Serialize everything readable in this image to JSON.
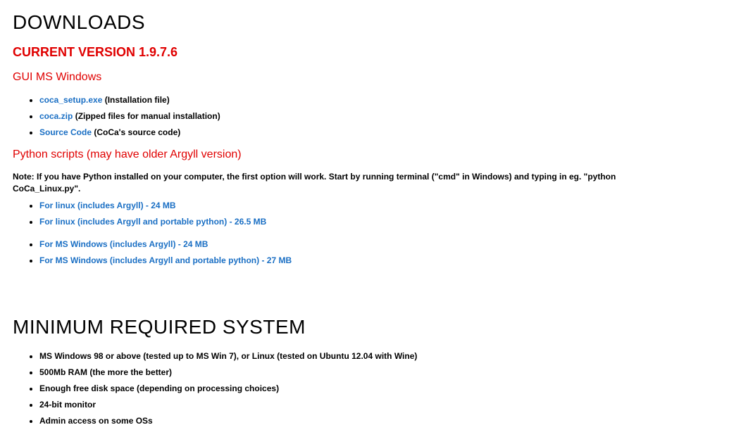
{
  "headings": {
    "downloads": "DOWNLOADS",
    "current_version": "CURRENT VERSION 1.9.7.6",
    "gui_windows": "GUI MS Windows",
    "python_scripts": "Python scripts (may have older Argyll version)",
    "min_req": "MINIMUM REQUIRED SYSTEM"
  },
  "gui_items": [
    {
      "link": "coca_setup.exe",
      "desc": " (Installation file)"
    },
    {
      "link": "coca.zip",
      "desc": " (Zipped files for manual installation)"
    },
    {
      "link": "Source Code",
      "desc": " (CoCa's source code)"
    }
  ],
  "note": "Note: If you have Python installed on your computer, the first option will work. Start by running terminal (\"cmd\" in Windows) and typing in eg. \"python CoCa_Linux.py\".",
  "py_linux": [
    {
      "link": "For linux (includes Argyll) - 24 MB"
    },
    {
      "link": "For linux (includes Argyll and portable python) - 26.5 MB"
    }
  ],
  "py_win": [
    {
      "link": "For MS Windows (includes Argyll) - 24 MB"
    },
    {
      "link": "For MS Windows (includes Argyll and portable python) - 27 MB"
    }
  ],
  "requirements": [
    "MS Windows 98 or above (tested up to MS Win 7), or Linux (tested on Ubuntu 12.04 with Wine)",
    "500Mb RAM (the more the better)",
    "Enough free disk space (depending on processing choices)",
    "24-bit monitor",
    "Admin access on some OSs"
  ]
}
